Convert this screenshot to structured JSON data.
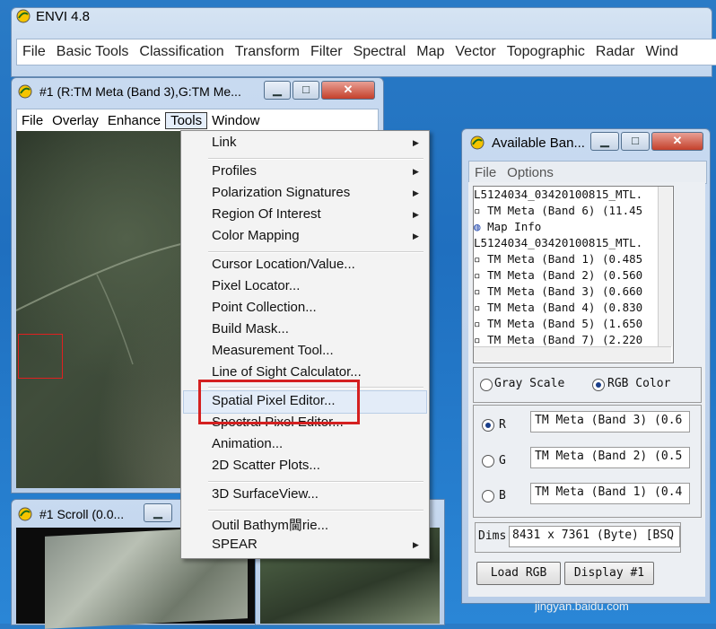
{
  "envi": {
    "title": "ENVI 4.8",
    "menu": [
      "File",
      "Basic Tools",
      "Classification",
      "Transform",
      "Filter",
      "Spectral",
      "Map",
      "Vector",
      "Topographic",
      "Radar",
      "Wind"
    ]
  },
  "image_window": {
    "title": "#1 (R:TM Meta (Band 3),G:TM Me...",
    "menu": [
      "File",
      "Overlay",
      "Enhance",
      "Tools",
      "Window"
    ],
    "active_menu": "Tools"
  },
  "tools_menu": {
    "items": [
      {
        "label": "Link",
        "submenu": true
      },
      {
        "label": "Profiles",
        "submenu": true
      },
      {
        "label": "Polarization Signatures",
        "submenu": true
      },
      {
        "label": "Region Of Interest",
        "submenu": true
      },
      {
        "label": "Color Mapping",
        "submenu": true
      },
      {
        "label": "Cursor Location/Value...",
        "submenu": false
      },
      {
        "label": "Pixel Locator...",
        "submenu": false
      },
      {
        "label": "Point Collection...",
        "submenu": false
      },
      {
        "label": "Build Mask...",
        "submenu": false
      },
      {
        "label": "Measurement Tool...",
        "submenu": false
      },
      {
        "label": "Line of Sight Calculator...",
        "submenu": false
      },
      {
        "label": "Spatial Pixel Editor...",
        "submenu": false,
        "highlighted": true
      },
      {
        "label": "Spectral Pixel Editor...",
        "submenu": false
      },
      {
        "label": "Animation...",
        "submenu": false
      },
      {
        "label": "2D Scatter Plots...",
        "submenu": false
      },
      {
        "label": "3D SurfaceView...",
        "submenu": false
      },
      {
        "label": "Outil Bathym閫rie...",
        "submenu": false
      },
      {
        "label": "SPEAR",
        "submenu": true
      }
    ]
  },
  "scroll_window": {
    "title": "#1 Scroll (0.0..."
  },
  "bands_window": {
    "title": "Available Ban...",
    "menu": [
      "File",
      "Options"
    ],
    "list": [
      "L5124034_03420100815_MTL.",
      "▫ TM Meta (Band 6) (11.45",
      "Map Info",
      "L5124034_03420100815_MTL.",
      "▫ TM Meta (Band 1) (0.485",
      "▫ TM Meta (Band 2) (0.560",
      "▫ TM Meta (Band 3) (0.660",
      "▫ TM Meta (Band 4) (0.830",
      "▫ TM Meta (Band 5) (1.650",
      "▫ TM Meta (Band 7) (2.220"
    ],
    "mode_gray": "Gray Scale",
    "mode_rgb": "RGB Color",
    "mode_selected": "RGB Color",
    "r_label": "R",
    "g_label": "G",
    "b_label": "B",
    "r_value": "TM Meta (Band 3) (0.6",
    "g_value": "TM Meta (Band 2) (0.5",
    "b_value": "TM Meta (Band 1) (0.4",
    "dims_label": "Dims",
    "dims_value": "8431 x 7361 (Byte) [BSQ",
    "load_button": "Load RGB",
    "display_button": "Display #1"
  },
  "watermark": "jingyan.baidu.com"
}
